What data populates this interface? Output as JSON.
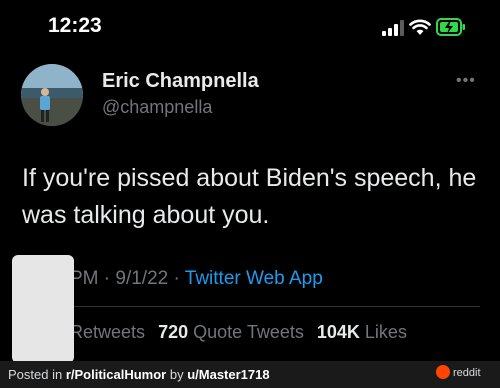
{
  "status_bar": {
    "time": "12:23"
  },
  "tweet": {
    "author_name": "Eric Champnella",
    "author_handle": "@champnella",
    "text": "If you're pissed about Biden's speech, he was talking about you.",
    "meta_time_date": "PM · 9/1/22 · ",
    "meta_source": "Twitter Web App",
    "stats": {
      "retweets_label": "Retweets",
      "quote_count": "720",
      "quote_label": "Quote Tweets",
      "likes_count": "104K",
      "likes_label": "Likes"
    }
  },
  "footer": {
    "posted_in": "Posted in ",
    "subreddit": "r/PoliticalHumor",
    "by": " by ",
    "user": "u/Master1718",
    "brand": "reddit"
  },
  "colors": {
    "background": "#000000",
    "text": "#e7e9ea",
    "muted": "#71767b",
    "link": "#1d9bf0",
    "footer_bg": "#1a1a1b",
    "reddit_orange": "#ff4500"
  }
}
